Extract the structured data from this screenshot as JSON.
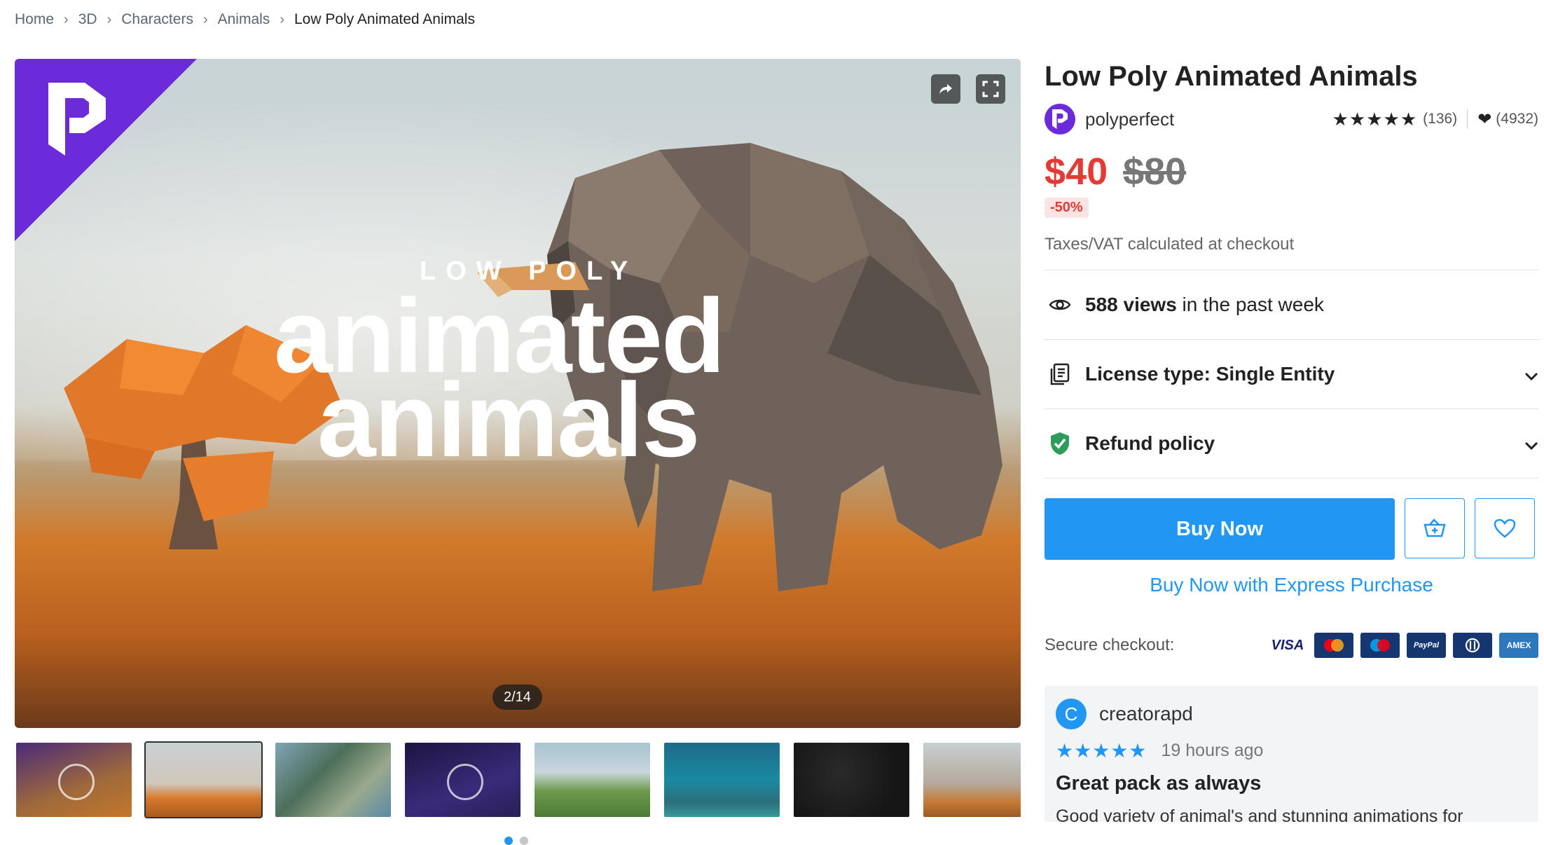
{
  "breadcrumb": {
    "items": [
      "Home",
      "3D",
      "Characters",
      "Animals",
      "Low Poly Animated Animals"
    ]
  },
  "gallery": {
    "hero_small_text": "LOW POLY",
    "hero_line1": "animated",
    "hero_line2": "animals",
    "counter": "2/14",
    "share_icon": "share-icon",
    "fullscreen_icon": "fullscreen-icon",
    "thumb_count": 8,
    "active_thumb_index": 1,
    "pagination_dots": 2,
    "active_dot_index": 0
  },
  "product": {
    "title": "Low Poly Animated Animals",
    "publisher": "polyperfect",
    "rating_stars": 5,
    "rating_count": "(136)",
    "favorites_count": "(4932)",
    "price": "$40",
    "old_price": "$80",
    "discount": "-50%",
    "tax_note": "Taxes/VAT calculated at checkout",
    "views_count": "588 views",
    "views_suffix": " in the past week",
    "license_label": "License type: Single Entity",
    "refund_label": "Refund policy",
    "buy_now_label": "Buy Now",
    "express_label": "Buy Now with Express Purchase",
    "secure_label": "Secure checkout:",
    "payment_cards": [
      "VISA",
      "mastercard",
      "maestro",
      "PayPal",
      "diners",
      "amex"
    ]
  },
  "review": {
    "avatar_letter": "C",
    "author": "creatorapd",
    "stars": 5,
    "time": "19 hours ago",
    "title": "Great pack as always",
    "body": "Good variety of animal's and stunning animations for"
  },
  "colors": {
    "accent_blue": "#2196f3",
    "sale_red": "#e53935",
    "brand_purple": "#6c2bd9"
  }
}
